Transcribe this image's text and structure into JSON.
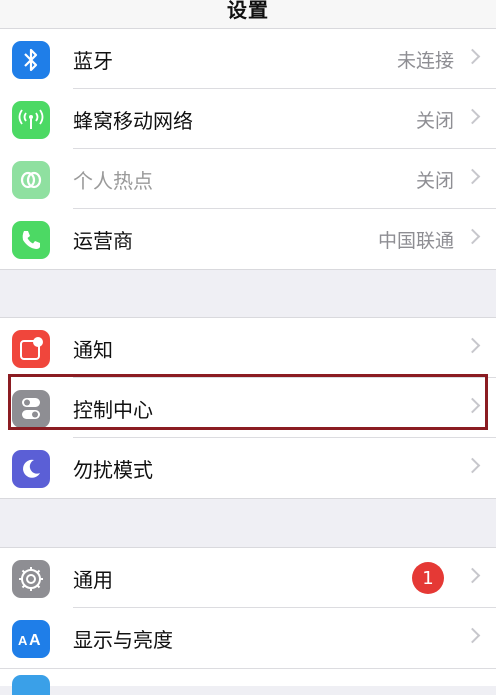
{
  "header": {
    "title": "设置"
  },
  "group1": [
    {
      "label": "蓝牙",
      "value": "未连接",
      "icon": "bluetooth-icon",
      "color": "#1f7ee8"
    },
    {
      "label": "蜂窝移动网络",
      "value": "关闭",
      "icon": "cellular-icon",
      "color": "#4cd964"
    },
    {
      "label": "个人热点",
      "value": "关闭",
      "icon": "hotspot-icon",
      "color": "#8fe0a0"
    },
    {
      "label": "运营商",
      "value": "中国联通",
      "icon": "phone-icon",
      "color": "#4cd964"
    }
  ],
  "group2": [
    {
      "label": "通知",
      "icon": "notifications-icon",
      "color": "#f0463c"
    },
    {
      "label": "控制中心",
      "icon": "control-center-icon",
      "color": "#8e8e93"
    },
    {
      "label": "勿扰模式",
      "icon": "moon-icon",
      "color": "#5b5fd6"
    }
  ],
  "group3": [
    {
      "label": "通用",
      "badge": "1",
      "icon": "gear-icon",
      "color": "#8e8e93"
    },
    {
      "label": "显示与亮度",
      "icon": "display-aa-icon",
      "color": "#1f7ee8"
    }
  ],
  "highlight_color": "#8b1c22"
}
